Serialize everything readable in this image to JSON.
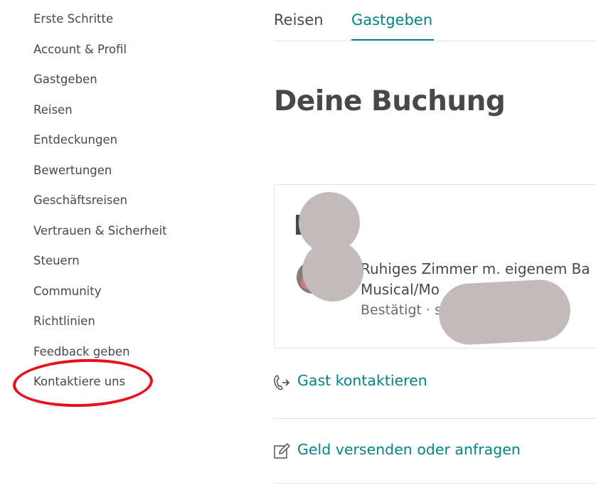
{
  "sidebar": {
    "items": [
      {
        "label": "Erste Schritte"
      },
      {
        "label": "Account & Profil"
      },
      {
        "label": "Gastgeben"
      },
      {
        "label": "Reisen"
      },
      {
        "label": "Entdeckungen"
      },
      {
        "label": "Bewertungen"
      },
      {
        "label": "Geschäftsreisen"
      },
      {
        "label": "Vertrauen & Sicherheit"
      },
      {
        "label": "Steuern"
      },
      {
        "label": "Community"
      },
      {
        "label": "Richtlinien"
      },
      {
        "label": "Feedback geben"
      },
      {
        "label": "Kontaktiere uns"
      }
    ],
    "highlight_color": "#e8101a"
  },
  "tabs": [
    {
      "label": "Reisen",
      "active": false
    },
    {
      "label": "Gastgeben",
      "active": true
    }
  ],
  "accent_color": "#008489",
  "page": {
    "title": "Deine Buchung"
  },
  "booking": {
    "listing_line1": "Ruhiges Zimmer m. eigenem Ba",
    "listing_line2": "Musical/Mo",
    "status": "Bestätigt · s"
  },
  "actions": [
    {
      "label": "Gast kontaktieren",
      "icon": "phone-arrow-icon"
    },
    {
      "label": "Geld versenden oder anfragen",
      "icon": "edit-icon"
    }
  ]
}
